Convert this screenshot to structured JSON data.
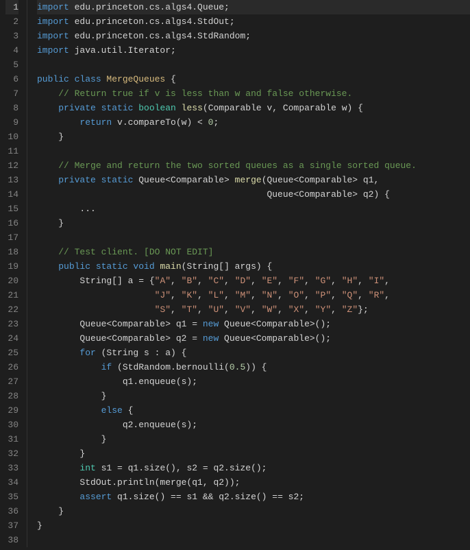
{
  "lines": [
    {
      "n": 1,
      "hl": true,
      "tokens": [
        [
          "kw",
          "import"
        ],
        [
          "pun",
          " edu.princeton.cs.algs4.Queue;"
        ]
      ]
    },
    {
      "n": 2,
      "hl": false,
      "tokens": [
        [
          "kw",
          "import"
        ],
        [
          "pun",
          " edu.princeton.cs.algs4.StdOut;"
        ]
      ]
    },
    {
      "n": 3,
      "hl": false,
      "tokens": [
        [
          "kw",
          "import"
        ],
        [
          "pun",
          " edu.princeton.cs.algs4.StdRandom;"
        ]
      ]
    },
    {
      "n": 4,
      "hl": false,
      "tokens": [
        [
          "kw",
          "import"
        ],
        [
          "pun",
          " java.util.Iterator;"
        ]
      ]
    },
    {
      "n": 5,
      "hl": false,
      "tokens": [
        [
          "pun",
          ""
        ]
      ]
    },
    {
      "n": 6,
      "hl": false,
      "tokens": [
        [
          "kw",
          "public class "
        ],
        [
          "clsn",
          "MergeQueues"
        ],
        [
          "pun",
          " {"
        ]
      ]
    },
    {
      "n": 7,
      "hl": false,
      "tokens": [
        [
          "pun",
          "    "
        ],
        [
          "cmt",
          "// Return true if v is less than w and false otherwise."
        ]
      ]
    },
    {
      "n": 8,
      "hl": false,
      "tokens": [
        [
          "pun",
          "    "
        ],
        [
          "kw",
          "private static "
        ],
        [
          "type",
          "boolean"
        ],
        [
          "pun",
          " "
        ],
        [
          "name",
          "less"
        ],
        [
          "pun",
          "(Comparable v, Comparable w) {"
        ]
      ]
    },
    {
      "n": 9,
      "hl": false,
      "tokens": [
        [
          "pun",
          "        "
        ],
        [
          "kw",
          "return"
        ],
        [
          "pun",
          " v.compareTo(w) < "
        ],
        [
          "num",
          "0"
        ],
        [
          "pun",
          ";"
        ]
      ]
    },
    {
      "n": 10,
      "hl": false,
      "tokens": [
        [
          "pun",
          "    }"
        ]
      ]
    },
    {
      "n": 11,
      "hl": false,
      "tokens": [
        [
          "pun",
          ""
        ]
      ]
    },
    {
      "n": 12,
      "hl": false,
      "tokens": [
        [
          "pun",
          "    "
        ],
        [
          "cmt",
          "// Merge and return the two sorted queues as a single sorted queue."
        ]
      ]
    },
    {
      "n": 13,
      "hl": false,
      "tokens": [
        [
          "pun",
          "    "
        ],
        [
          "kw",
          "private static"
        ],
        [
          "pun",
          " Queue<Comparable> "
        ],
        [
          "name",
          "merge"
        ],
        [
          "pun",
          "(Queue<Comparable> q1,"
        ]
      ]
    },
    {
      "n": 14,
      "hl": false,
      "tokens": [
        [
          "pun",
          "                                           Queue<Comparable> q2) {"
        ]
      ]
    },
    {
      "n": 15,
      "hl": false,
      "tokens": [
        [
          "pun",
          "        ..."
        ]
      ]
    },
    {
      "n": 16,
      "hl": false,
      "tokens": [
        [
          "pun",
          "    }"
        ]
      ]
    },
    {
      "n": 17,
      "hl": false,
      "tokens": [
        [
          "pun",
          ""
        ]
      ]
    },
    {
      "n": 18,
      "hl": false,
      "tokens": [
        [
          "pun",
          "    "
        ],
        [
          "cmt",
          "// Test client. [DO NOT EDIT]"
        ]
      ]
    },
    {
      "n": 19,
      "hl": false,
      "tokens": [
        [
          "pun",
          "    "
        ],
        [
          "kw",
          "public static void "
        ],
        [
          "name",
          "main"
        ],
        [
          "pun",
          "(String[] args) {"
        ]
      ]
    },
    {
      "n": 20,
      "hl": false,
      "tokens": [
        [
          "pun",
          "        String[] a = {"
        ],
        [
          "str",
          "\"A\""
        ],
        [
          "pun",
          ", "
        ],
        [
          "str",
          "\"B\""
        ],
        [
          "pun",
          ", "
        ],
        [
          "str",
          "\"C\""
        ],
        [
          "pun",
          ", "
        ],
        [
          "str",
          "\"D\""
        ],
        [
          "pun",
          ", "
        ],
        [
          "str",
          "\"E\""
        ],
        [
          "pun",
          ", "
        ],
        [
          "str",
          "\"F\""
        ],
        [
          "pun",
          ", "
        ],
        [
          "str",
          "\"G\""
        ],
        [
          "pun",
          ", "
        ],
        [
          "str",
          "\"H\""
        ],
        [
          "pun",
          ", "
        ],
        [
          "str",
          "\"I\""
        ],
        [
          "pun",
          ","
        ]
      ]
    },
    {
      "n": 21,
      "hl": false,
      "tokens": [
        [
          "pun",
          "                      "
        ],
        [
          "str",
          "\"J\""
        ],
        [
          "pun",
          ", "
        ],
        [
          "str",
          "\"K\""
        ],
        [
          "pun",
          ", "
        ],
        [
          "str",
          "\"L\""
        ],
        [
          "pun",
          ", "
        ],
        [
          "str",
          "\"M\""
        ],
        [
          "pun",
          ", "
        ],
        [
          "str",
          "\"N\""
        ],
        [
          "pun",
          ", "
        ],
        [
          "str",
          "\"O\""
        ],
        [
          "pun",
          ", "
        ],
        [
          "str",
          "\"P\""
        ],
        [
          "pun",
          ", "
        ],
        [
          "str",
          "\"Q\""
        ],
        [
          "pun",
          ", "
        ],
        [
          "str",
          "\"R\""
        ],
        [
          "pun",
          ","
        ]
      ]
    },
    {
      "n": 22,
      "hl": false,
      "tokens": [
        [
          "pun",
          "                      "
        ],
        [
          "str",
          "\"S\""
        ],
        [
          "pun",
          ", "
        ],
        [
          "str",
          "\"T\""
        ],
        [
          "pun",
          ", "
        ],
        [
          "str",
          "\"U\""
        ],
        [
          "pun",
          ", "
        ],
        [
          "str",
          "\"V\""
        ],
        [
          "pun",
          ", "
        ],
        [
          "str",
          "\"W\""
        ],
        [
          "pun",
          ", "
        ],
        [
          "str",
          "\"X\""
        ],
        [
          "pun",
          ", "
        ],
        [
          "str",
          "\"Y\""
        ],
        [
          "pun",
          ", "
        ],
        [
          "str",
          "\"Z\""
        ],
        [
          "pun",
          "};"
        ]
      ]
    },
    {
      "n": 23,
      "hl": false,
      "tokens": [
        [
          "pun",
          "        Queue<Comparable> q1 = "
        ],
        [
          "kw",
          "new"
        ],
        [
          "pun",
          " Queue<Comparable>();"
        ]
      ]
    },
    {
      "n": 24,
      "hl": false,
      "tokens": [
        [
          "pun",
          "        Queue<Comparable> q2 = "
        ],
        [
          "kw",
          "new"
        ],
        [
          "pun",
          " Queue<Comparable>();"
        ]
      ]
    },
    {
      "n": 25,
      "hl": false,
      "tokens": [
        [
          "pun",
          "        "
        ],
        [
          "kw",
          "for"
        ],
        [
          "pun",
          " (String s : a) {"
        ]
      ]
    },
    {
      "n": 26,
      "hl": false,
      "tokens": [
        [
          "pun",
          "            "
        ],
        [
          "kw",
          "if"
        ],
        [
          "pun",
          " (StdRandom.bernoulli("
        ],
        [
          "num",
          "0.5"
        ],
        [
          "pun",
          ")) {"
        ]
      ]
    },
    {
      "n": 27,
      "hl": false,
      "tokens": [
        [
          "pun",
          "                q1.enqueue(s);"
        ]
      ]
    },
    {
      "n": 28,
      "hl": false,
      "tokens": [
        [
          "pun",
          "            }"
        ]
      ]
    },
    {
      "n": 29,
      "hl": false,
      "tokens": [
        [
          "pun",
          "            "
        ],
        [
          "kw",
          "else"
        ],
        [
          "pun",
          " {"
        ]
      ]
    },
    {
      "n": 30,
      "hl": false,
      "tokens": [
        [
          "pun",
          "                q2.enqueue(s);"
        ]
      ]
    },
    {
      "n": 31,
      "hl": false,
      "tokens": [
        [
          "pun",
          "            }"
        ]
      ]
    },
    {
      "n": 32,
      "hl": false,
      "tokens": [
        [
          "pun",
          "        }"
        ]
      ]
    },
    {
      "n": 33,
      "hl": false,
      "tokens": [
        [
          "pun",
          "        "
        ],
        [
          "type",
          "int"
        ],
        [
          "pun",
          " s1 = q1.size(), s2 = q2.size();"
        ]
      ]
    },
    {
      "n": 34,
      "hl": false,
      "tokens": [
        [
          "pun",
          "        StdOut.println(merge(q1, q2));"
        ]
      ]
    },
    {
      "n": 35,
      "hl": false,
      "tokens": [
        [
          "pun",
          "        "
        ],
        [
          "kw",
          "assert"
        ],
        [
          "pun",
          " q1.size() == s1 && q2.size() == s2;"
        ]
      ]
    },
    {
      "n": 36,
      "hl": false,
      "tokens": [
        [
          "pun",
          "    }"
        ]
      ]
    },
    {
      "n": 37,
      "hl": false,
      "tokens": [
        [
          "pun",
          "}"
        ]
      ]
    },
    {
      "n": 38,
      "hl": false,
      "tokens": [
        [
          "pun",
          ""
        ]
      ]
    }
  ]
}
